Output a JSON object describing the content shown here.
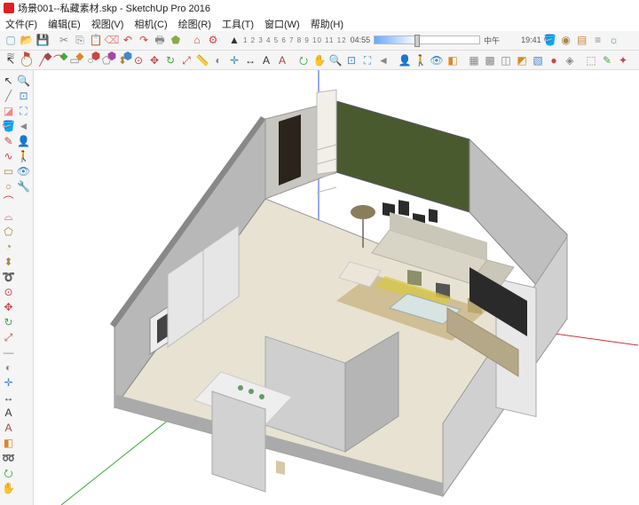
{
  "titlebar": {
    "filename": "场景001--私藏素材.skp",
    "app": "SketchUp Pro 2016"
  },
  "menubar": [
    "文件(F)",
    "编辑(E)",
    "视图(V)",
    "相机(C)",
    "绘图(R)",
    "工具(T)",
    "窗口(W)",
    "帮助(H)"
  ],
  "timeline": {
    "frames": "1 2 3 4 5 6 7 8 9 10 11 12",
    "t1": "04:55",
    "mid": "中午",
    "t2": "19:41"
  },
  "top_tools": [
    {
      "n": "new",
      "c": "#6ab",
      "g": "▢"
    },
    {
      "n": "open",
      "c": "#d90",
      "g": "📂"
    },
    {
      "n": "save",
      "c": "#55b",
      "g": "💾"
    },
    {
      "s": 1
    },
    {
      "n": "cut",
      "c": "#888",
      "g": "✂"
    },
    {
      "n": "copy",
      "c": "#888",
      "g": "⎘"
    },
    {
      "n": "paste",
      "c": "#888",
      "g": "📋"
    },
    {
      "n": "erase",
      "c": "#e88",
      "g": "⌫"
    },
    {
      "n": "undo",
      "c": "#c44",
      "g": "↶"
    },
    {
      "n": "redo",
      "c": "#c44",
      "g": "↷"
    },
    {
      "n": "print",
      "c": "#888",
      "g": "🖶"
    },
    {
      "n": "model",
      "c": "#8a4",
      "g": "⬟"
    },
    {
      "s": 1
    },
    {
      "n": "warehouse",
      "c": "#c44",
      "g": "⌂"
    },
    {
      "n": "ext",
      "c": "#c44",
      "g": "⚙"
    },
    {
      "s": 1
    },
    {
      "n": "select",
      "c": "#333",
      "g": "▲"
    }
  ],
  "top_tools2_right": [
    {
      "n": "paint",
      "c": "#8a4",
      "g": "🪣"
    },
    {
      "n": "sample",
      "c": "#a84",
      "g": "◉"
    },
    {
      "n": "layer",
      "c": "#c84",
      "g": "▤"
    },
    {
      "n": "outliner",
      "c": "#888",
      "g": "≡"
    },
    {
      "n": "shadow",
      "c": "#48a",
      "g": "☼"
    },
    {
      "n": "fog",
      "c": "#888",
      "g": "≋"
    },
    {
      "n": "comp",
      "c": "#c44",
      "g": "⚑"
    },
    {
      "s": 1
    },
    {
      "n": "plugin1",
      "c": "#a44",
      "g": "◆"
    },
    {
      "n": "plugin2",
      "c": "#4a4",
      "g": "◆"
    },
    {
      "n": "plugin3",
      "c": "#d82",
      "g": "◆"
    },
    {
      "n": "plugin4",
      "c": "#c44",
      "g": "⬢"
    },
    {
      "n": "plugin5",
      "c": "#a4a",
      "g": "⬢"
    },
    {
      "n": "plugin6",
      "c": "#48c",
      "g": "⬢"
    }
  ],
  "bottom_tools": [
    {
      "n": "select2",
      "c": "#333",
      "g": "↖"
    },
    {
      "n": "lasso",
      "c": "#a84",
      "g": "◯"
    },
    {
      "n": "line",
      "c": "#c44",
      "g": "╱"
    },
    {
      "n": "arc",
      "c": "#c44",
      "g": "⌒"
    },
    {
      "n": "rect",
      "c": "#888",
      "g": "▭"
    },
    {
      "n": "circle",
      "c": "#888",
      "g": "○"
    },
    {
      "n": "poly",
      "c": "#888",
      "g": "⬠"
    },
    {
      "n": "push",
      "c": "#a84",
      "g": "⬍"
    },
    {
      "n": "offset",
      "c": "#c44",
      "g": "⊙"
    },
    {
      "n": "move",
      "c": "#c44",
      "g": "✥"
    },
    {
      "n": "rotate",
      "c": "#4a4",
      "g": "↻"
    },
    {
      "n": "scale",
      "c": "#c44",
      "g": "⤢"
    },
    {
      "n": "tape",
      "c": "#888",
      "g": "📏"
    },
    {
      "n": "protractor",
      "c": "#888",
      "g": "◐"
    },
    {
      "n": "axes",
      "c": "#48c",
      "g": "✛"
    },
    {
      "n": "dim",
      "c": "#333",
      "g": "↔"
    },
    {
      "n": "text",
      "c": "#333",
      "g": "A"
    },
    {
      "n": "3dtext",
      "c": "#a44",
      "g": "A"
    },
    {
      "s": 1
    },
    {
      "n": "orbit",
      "c": "#4a4",
      "g": "⭮"
    },
    {
      "n": "pan",
      "c": "#a84",
      "g": "✋"
    },
    {
      "n": "zoom",
      "c": "#48c",
      "g": "🔍"
    },
    {
      "n": "zoomwin",
      "c": "#48c",
      "g": "⊡"
    },
    {
      "n": "zoomext",
      "c": "#48c",
      "g": "⛶"
    },
    {
      "n": "prev",
      "c": "#888",
      "g": "◄"
    },
    {
      "s": 1
    },
    {
      "n": "position",
      "c": "#4a4",
      "g": "👤"
    },
    {
      "n": "walk",
      "c": "#4a4",
      "g": "🚶"
    },
    {
      "n": "look",
      "c": "#48c",
      "g": "👁"
    },
    {
      "n": "section",
      "c": "#d82",
      "g": "◧"
    },
    {
      "s": 1
    },
    {
      "n": "style1",
      "c": "#888",
      "g": "▦"
    },
    {
      "n": "style2",
      "c": "#888",
      "g": "▩"
    },
    {
      "n": "style3",
      "c": "#888",
      "g": "◫"
    },
    {
      "n": "style4",
      "c": "#d82",
      "g": "◩"
    },
    {
      "n": "style5",
      "c": "#48c",
      "g": "▧"
    },
    {
      "n": "style6",
      "c": "#c44",
      "g": "●"
    },
    {
      "n": "xray",
      "c": "#888",
      "g": "◈"
    },
    {
      "s": 1
    },
    {
      "n": "comp-make",
      "c": "#a84",
      "g": "⬚"
    },
    {
      "n": "comp-edit",
      "c": "#4a4",
      "g": "✎"
    },
    {
      "n": "explode",
      "c": "#c44",
      "g": "✦"
    }
  ],
  "side_tools": [
    {
      "n": "select",
      "c": "#333",
      "g": "↖"
    },
    {
      "n": "line",
      "c": "#888",
      "g": "╱"
    },
    {
      "n": "eraser",
      "c": "#e88",
      "g": "◪"
    },
    {
      "n": "paint",
      "c": "#d90",
      "g": "🪣"
    },
    {
      "n": "pencil",
      "c": "#c44",
      "g": "✎"
    },
    {
      "n": "freehand",
      "c": "#c44",
      "g": "∿"
    },
    {
      "n": "rect",
      "c": "#a84",
      "g": "▭"
    },
    {
      "n": "circle",
      "c": "#a84",
      "g": "○"
    },
    {
      "n": "arc",
      "c": "#c44",
      "g": "⌒"
    },
    {
      "n": "arc2",
      "c": "#c44",
      "g": "⌓"
    },
    {
      "n": "poly",
      "c": "#a84",
      "g": "⬠"
    },
    {
      "n": "pie",
      "c": "#a84",
      "g": "◔"
    },
    {
      "n": "push",
      "c": "#a84",
      "g": "⬍"
    },
    {
      "n": "follow",
      "c": "#a84",
      "g": "➰"
    },
    {
      "n": "offset",
      "c": "#c44",
      "g": "⊙"
    },
    {
      "n": "move",
      "c": "#c44",
      "g": "✥"
    },
    {
      "n": "rotate",
      "c": "#4a4",
      "g": "↻"
    },
    {
      "n": "scale",
      "c": "#c44",
      "g": "⤢"
    },
    {
      "n": "tape",
      "c": "#888",
      "g": "—"
    },
    {
      "n": "prot",
      "c": "#888",
      "g": "◐"
    },
    {
      "n": "axes",
      "c": "#48c",
      "g": "✛"
    },
    {
      "n": "dim",
      "c": "#333",
      "g": "↔"
    },
    {
      "n": "text",
      "c": "#333",
      "g": "A"
    },
    {
      "n": "3dt",
      "c": "#a44",
      "g": "A"
    },
    {
      "n": "section",
      "c": "#d82",
      "g": "◧"
    },
    {
      "n": "follow2",
      "c": "#888",
      "g": "➿"
    },
    {
      "n": "orbit",
      "c": "#4a4",
      "g": "⭮"
    },
    {
      "n": "pan",
      "c": "#a84",
      "g": "✋"
    },
    {
      "n": "zoom",
      "c": "#48c",
      "g": "🔍"
    },
    {
      "n": "zoomw",
      "c": "#48c",
      "g": "⊡"
    },
    {
      "n": "zoome",
      "c": "#48c",
      "g": "⛶"
    },
    {
      "n": "prev",
      "c": "#888",
      "g": "◄"
    },
    {
      "n": "pos",
      "c": "#4a4",
      "g": "👤"
    },
    {
      "n": "walk",
      "c": "#4a4",
      "g": "🚶"
    },
    {
      "n": "look",
      "c": "#48c",
      "g": "👁"
    },
    {
      "n": "tool",
      "c": "#d82",
      "g": "🔧"
    }
  ]
}
